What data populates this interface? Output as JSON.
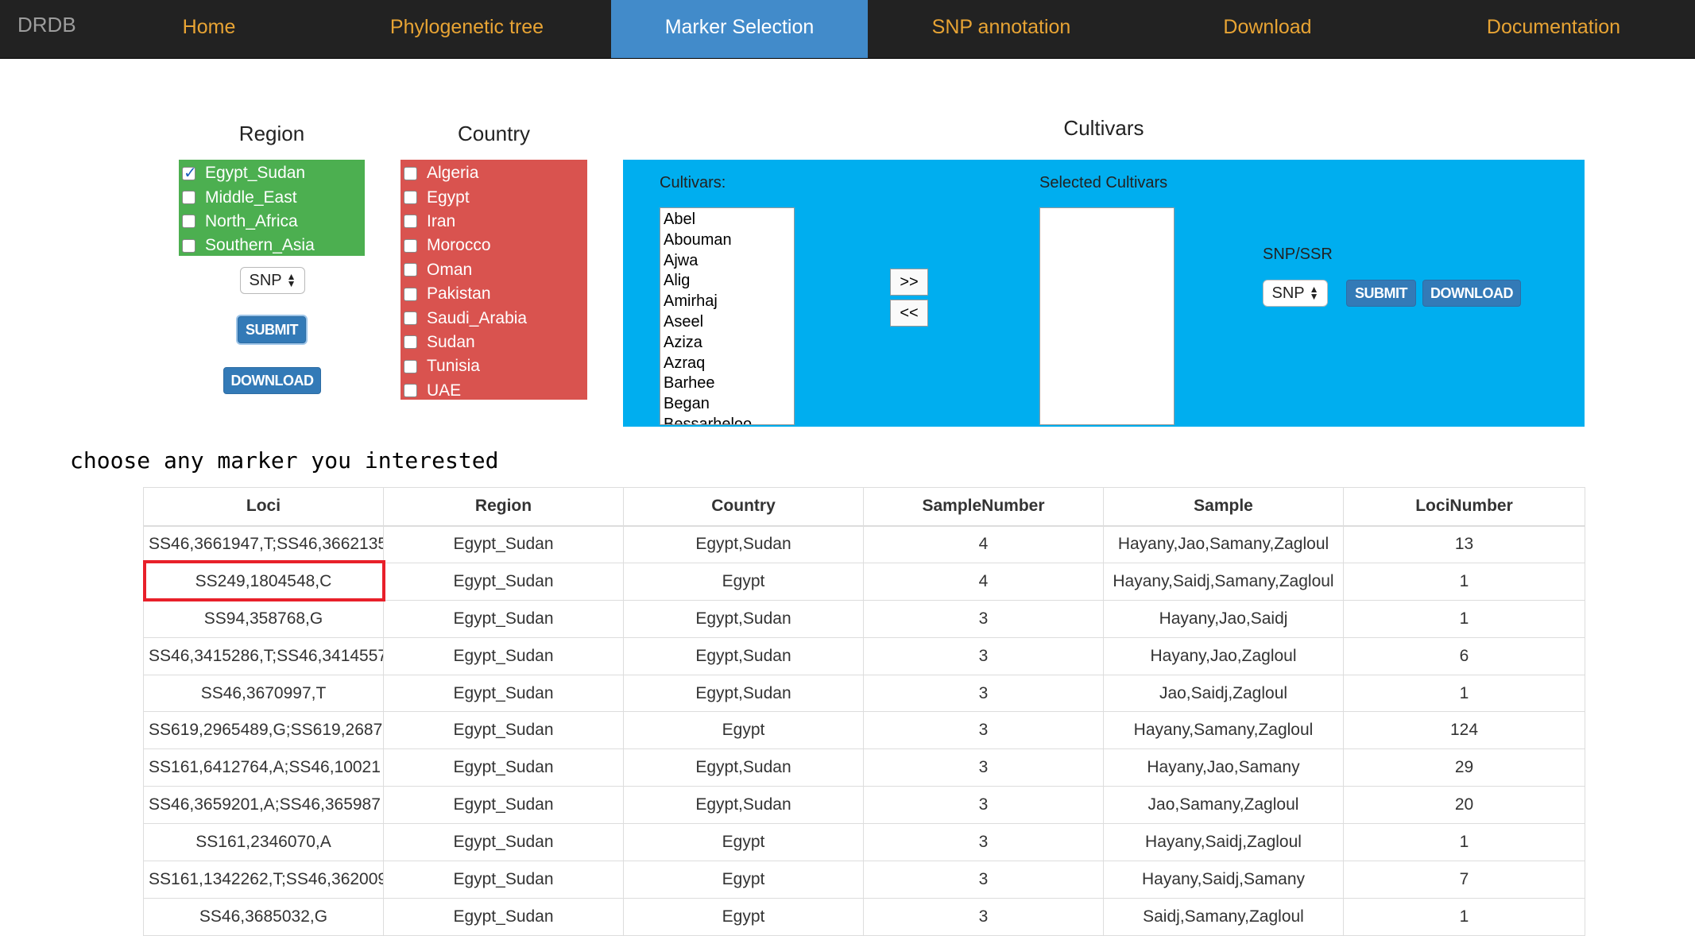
{
  "nav": {
    "brand": "DRDB",
    "items": [
      {
        "label": "Home",
        "active": false
      },
      {
        "label": "Phylogenetic tree",
        "active": false
      },
      {
        "label": "Marker Selection",
        "active": true
      },
      {
        "label": "SNP annotation",
        "active": false
      },
      {
        "label": "Download",
        "active": false
      },
      {
        "label": "Documentation",
        "active": false
      }
    ]
  },
  "region": {
    "title": "Region",
    "options": [
      {
        "label": "Egypt_Sudan",
        "checked": true
      },
      {
        "label": "Middle_East",
        "checked": false
      },
      {
        "label": "North_Africa",
        "checked": false
      },
      {
        "label": "Southern_Asia",
        "checked": false
      }
    ],
    "select_value": "SNP",
    "submit_label": "SUBMIT",
    "download_label": "DOWNLOAD"
  },
  "country": {
    "title": "Country",
    "options": [
      {
        "label": "Algeria",
        "checked": false
      },
      {
        "label": "Egypt",
        "checked": false
      },
      {
        "label": "Iran",
        "checked": false
      },
      {
        "label": "Morocco",
        "checked": false
      },
      {
        "label": "Oman",
        "checked": false
      },
      {
        "label": "Pakistan",
        "checked": false
      },
      {
        "label": "Saudi_Arabia",
        "checked": false
      },
      {
        "label": "Sudan",
        "checked": false
      },
      {
        "label": "Tunisia",
        "checked": false
      },
      {
        "label": "UAE",
        "checked": false
      }
    ]
  },
  "cultivars": {
    "title": "Cultivars",
    "list_label": "Cultivars:",
    "selected_label": "Selected Cultivars",
    "options": [
      "Abel",
      "Abouman",
      "Ajwa",
      "Alig",
      "Amirhaj",
      "Aseel",
      "Aziza",
      "Azraq",
      "Barhee",
      "Began",
      "Bessarheloo"
    ],
    "selected": [],
    "add_label": ">>",
    "remove_label": "<<",
    "snp_ssr_label": "SNP/SSR",
    "select_value": "SNP",
    "submit_label": "SUBMIT",
    "download_label": "DOWNLOAD"
  },
  "intro": "choose any marker you interested",
  "table": {
    "headers": [
      "Loci",
      "Region",
      "Country",
      "SampleNumber",
      "Sample",
      "LociNumber"
    ],
    "rows": [
      [
        "SS46,3661947,T;SS46,3662135",
        "Egypt_Sudan",
        "Egypt,Sudan",
        "4",
        "Hayany,Jao,Samany,Zagloul",
        "13"
      ],
      [
        "SS249,1804548,C",
        "Egypt_Sudan",
        "Egypt",
        "4",
        "Hayany,Saidj,Samany,Zagloul",
        "1"
      ],
      [
        "SS94,358768,G",
        "Egypt_Sudan",
        "Egypt,Sudan",
        "3",
        "Hayany,Jao,Saidj",
        "1"
      ],
      [
        "SS46,3415286,T;SS46,3414557",
        "Egypt_Sudan",
        "Egypt,Sudan",
        "3",
        "Hayany,Jao,Zagloul",
        "6"
      ],
      [
        "SS46,3670997,T",
        "Egypt_Sudan",
        "Egypt,Sudan",
        "3",
        "Jao,Saidj,Zagloul",
        "1"
      ],
      [
        "SS619,2965489,G;SS619,2687",
        "Egypt_Sudan",
        "Egypt",
        "3",
        "Hayany,Samany,Zagloul",
        "124"
      ],
      [
        "SS161,6412764,A;SS46,10021",
        "Egypt_Sudan",
        "Egypt,Sudan",
        "3",
        "Hayany,Jao,Samany",
        "29"
      ],
      [
        "SS46,3659201,A;SS46,365987",
        "Egypt_Sudan",
        "Egypt,Sudan",
        "3",
        "Jao,Samany,Zagloul",
        "20"
      ],
      [
        "SS161,2346070,A",
        "Egypt_Sudan",
        "Egypt",
        "3",
        "Hayany,Saidj,Zagloul",
        "1"
      ],
      [
        "SS161,1342262,T;SS46,362009",
        "Egypt_Sudan",
        "Egypt",
        "3",
        "Hayany,Saidj,Samany",
        "7"
      ],
      [
        "SS46,3685032,G",
        "Egypt_Sudan",
        "Egypt",
        "3",
        "Saidj,Samany,Zagloul",
        "1"
      ]
    ],
    "highlight_color": "#e8202a"
  },
  "colors": {
    "navbar": "#222222",
    "nav_text": "#e8a434",
    "nav_active": "#428bca",
    "region_panel": "#4caf50",
    "country_panel": "#d9534f",
    "cultivar_panel": "#00aeef",
    "button": "#337ab7"
  }
}
